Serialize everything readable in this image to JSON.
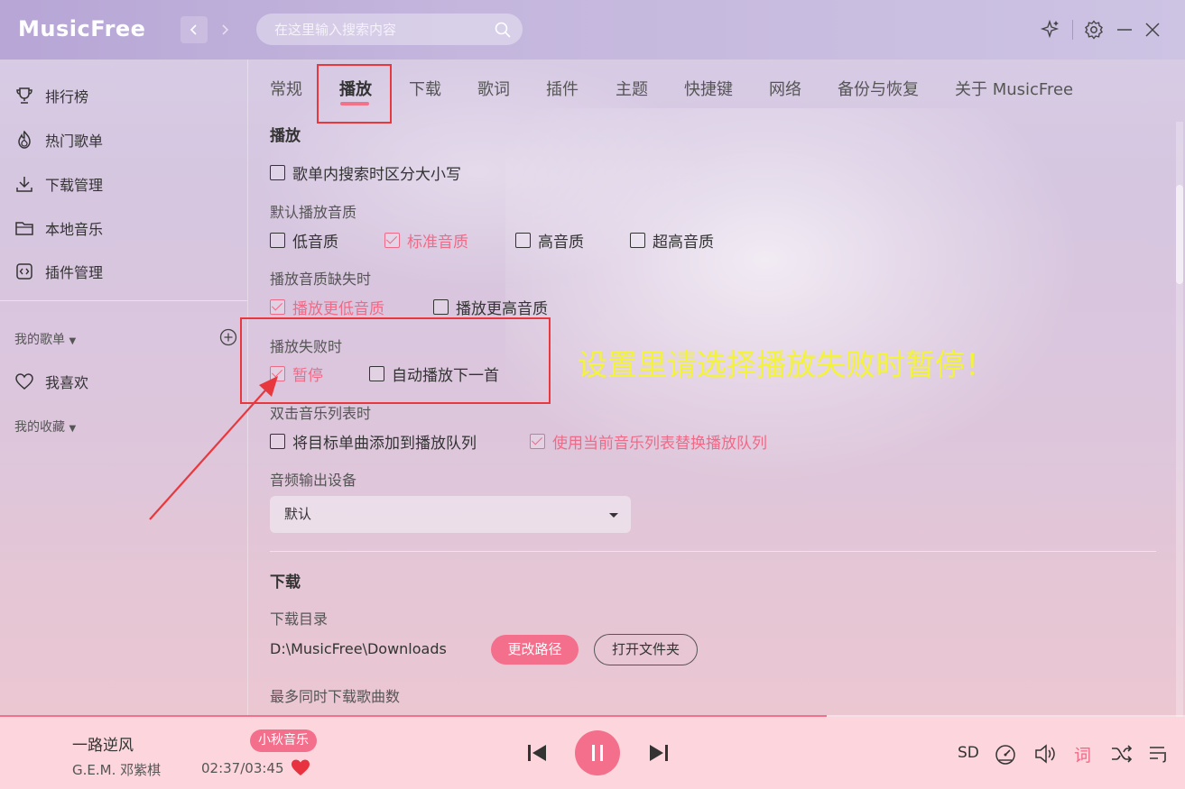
{
  "app": {
    "logo": "MusicFree",
    "search_placeholder": "在这里输入搜索内容"
  },
  "sidebar": {
    "items": [
      {
        "label": "排行榜",
        "icon": "trophy-icon"
      },
      {
        "label": "热门歌单",
        "icon": "fire-icon"
      },
      {
        "label": "下载管理",
        "icon": "download-icon"
      },
      {
        "label": "本地音乐",
        "icon": "folder-icon"
      },
      {
        "label": "插件管理",
        "icon": "plugin-icon"
      }
    ],
    "my_sheets_label": "我的歌单",
    "favorites_label": "我喜欢",
    "my_collections_label": "我的收藏"
  },
  "tabs": [
    "常规",
    "播放",
    "下载",
    "歌词",
    "插件",
    "主题",
    "快捷键",
    "网络",
    "备份与恢复",
    "关于 MusicFree"
  ],
  "active_tab": "播放",
  "playback": {
    "section_title": "播放",
    "case_sensitive": {
      "label": "歌单内搜索时区分大小写",
      "checked": false
    },
    "default_quality": {
      "label": "默认播放音质",
      "options": [
        {
          "label": "低音质",
          "checked": false
        },
        {
          "label": "标准音质",
          "checked": true
        },
        {
          "label": "高音质",
          "checked": false
        },
        {
          "label": "超高音质",
          "checked": false
        }
      ]
    },
    "quality_missing": {
      "label": "播放音质缺失时",
      "options": [
        {
          "label": "播放更低音质",
          "checked": true
        },
        {
          "label": "播放更高音质",
          "checked": false
        }
      ]
    },
    "on_fail": {
      "label": "播放失败时",
      "options": [
        {
          "label": "暂停",
          "checked": true
        },
        {
          "label": "自动播放下一首",
          "checked": false
        }
      ]
    },
    "double_click": {
      "label": "双击音乐列表时",
      "options": [
        {
          "label": "将目标单曲添加到播放队列",
          "checked": false
        },
        {
          "label": "使用当前音乐列表替换播放队列",
          "checked": true
        }
      ]
    },
    "audio_output": {
      "label": "音频输出设备",
      "value": "默认"
    }
  },
  "download": {
    "section_title": "下载",
    "dir_label": "下载目录",
    "dir_value": "D:\\MusicFree\\Downloads",
    "change_path_label": "更改路径",
    "open_folder_label": "打开文件夹",
    "max_concurrent_label": "最多同时下载歌曲数"
  },
  "annotation": {
    "text": "设置里请选择播放失败时暂停！",
    "color": "#f3f33a",
    "box_color": "#e8383d"
  },
  "player": {
    "title": "一路逆风",
    "artist": "G.E.M. 邓紫棋",
    "source": "小秋音乐",
    "time": "02:37/03:45",
    "progress": 0.698,
    "quality": "SD",
    "lyric_label": "词",
    "liked": true
  },
  "colors": {
    "accent": "#f36f8c"
  }
}
